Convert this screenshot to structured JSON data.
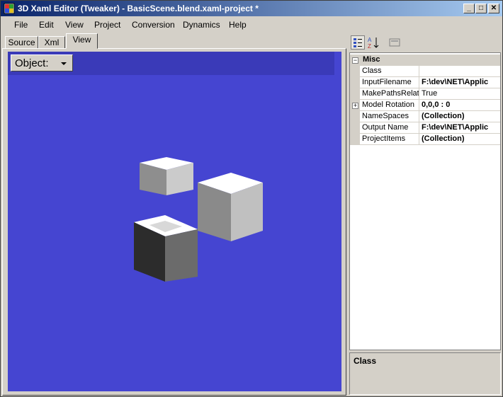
{
  "window": {
    "title": "3D Xaml Editor (Tweaker) - BasicScene.blend.xaml-project *",
    "minimize": "_",
    "maximize": "□",
    "close": "✕"
  },
  "menu": [
    "File",
    "Edit",
    "View",
    "Project",
    "Conversion",
    "Dynamics",
    "Help"
  ],
  "tabs": [
    {
      "label": "Source"
    },
    {
      "label": "Xml"
    },
    {
      "label": "View",
      "active": true
    }
  ],
  "viewport": {
    "object_label": "Object:",
    "background": "#4545d1"
  },
  "property_grid": {
    "toolbar": [
      "categorized-icon",
      "alphabetical-icon",
      "property-pages-icon"
    ],
    "category": {
      "expander": "−",
      "name": "Misc"
    },
    "rows": [
      {
        "name": "Class",
        "value": "",
        "bold": false,
        "expandable": false
      },
      {
        "name": "InputFilename",
        "value": "F:\\dev\\NET\\Applic",
        "bold": true,
        "expandable": false
      },
      {
        "name": "MakePathsRelat",
        "value": "True",
        "bold": false,
        "expandable": false
      },
      {
        "name": "Model Rotation",
        "value": "0,0,0 : 0",
        "bold": true,
        "expandable": true
      },
      {
        "name": "NameSpaces",
        "value": "(Collection)",
        "bold": true,
        "expandable": false
      },
      {
        "name": "Output Name",
        "value": "F:\\dev\\NET\\Applic",
        "bold": true,
        "expandable": false
      },
      {
        "name": "ProjectItems",
        "value": "(Collection)",
        "bold": true,
        "expandable": false
      }
    ]
  },
  "help": {
    "title": "Class"
  }
}
